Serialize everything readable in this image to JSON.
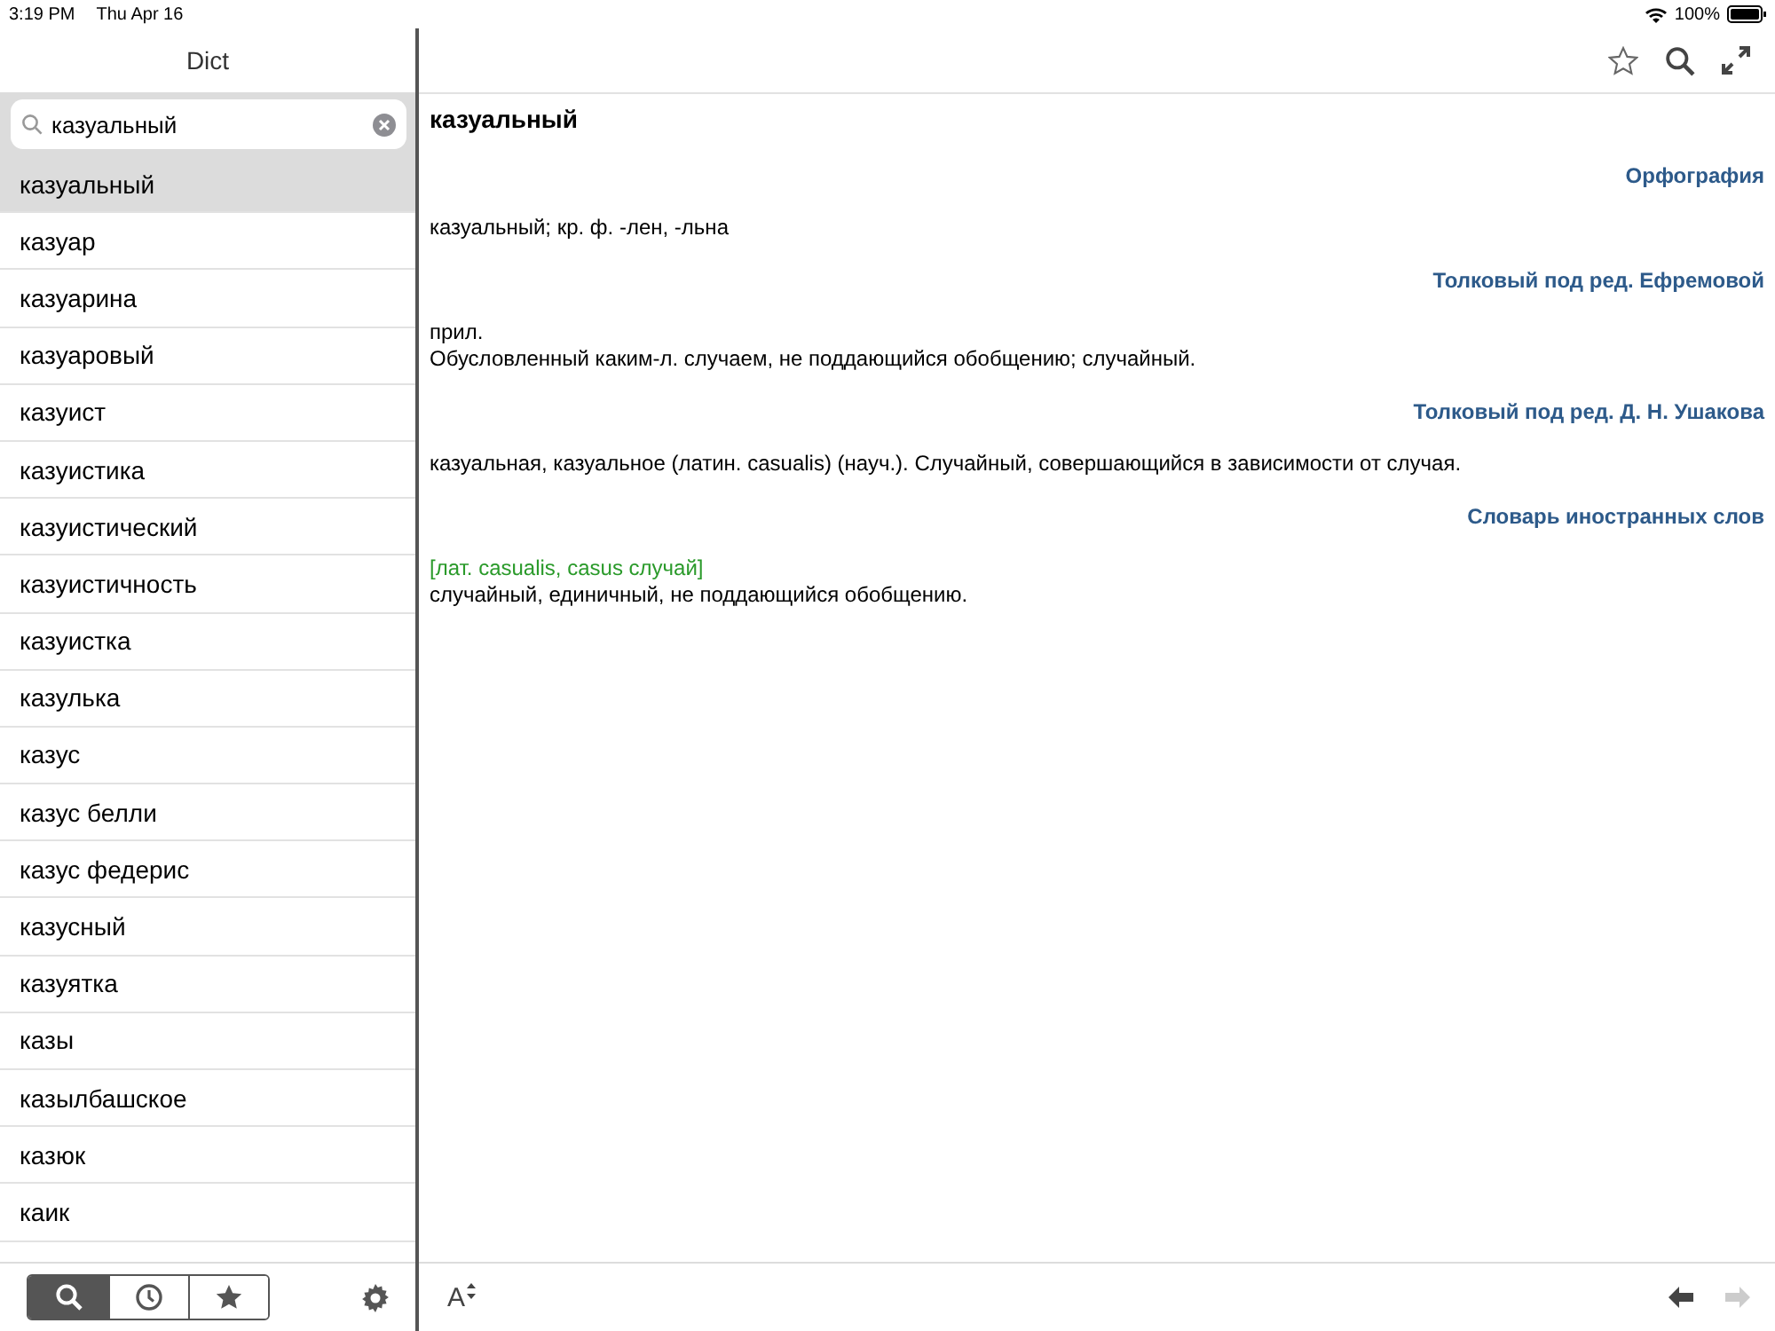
{
  "status_bar": {
    "time": "3:19 PM",
    "date": "Thu Apr 16",
    "battery": "100%"
  },
  "sidebar": {
    "title": "Dict",
    "search": {
      "value": "казуальный"
    },
    "items": [
      {
        "label": "казуальный",
        "selected": true
      },
      {
        "label": "казуар",
        "selected": false
      },
      {
        "label": "казуарина",
        "selected": false
      },
      {
        "label": "казуаровый",
        "selected": false
      },
      {
        "label": "казуист",
        "selected": false
      },
      {
        "label": "казуистика",
        "selected": false
      },
      {
        "label": "казуистический",
        "selected": false
      },
      {
        "label": "казуистичность",
        "selected": false
      },
      {
        "label": "казуистка",
        "selected": false
      },
      {
        "label": "казулька",
        "selected": false
      },
      {
        "label": "казус",
        "selected": false
      },
      {
        "label": "казус белли",
        "selected": false
      },
      {
        "label": "казус федерис",
        "selected": false
      },
      {
        "label": "казусный",
        "selected": false
      },
      {
        "label": "казуятка",
        "selected": false
      },
      {
        "label": "казы",
        "selected": false
      },
      {
        "label": "казылбашское",
        "selected": false
      },
      {
        "label": "казюк",
        "selected": false
      },
      {
        "label": "каик",
        "selected": false
      }
    ],
    "tabs": [
      {
        "kind": "search",
        "selected": true
      },
      {
        "kind": "history",
        "selected": false
      },
      {
        "kind": "favorites",
        "selected": false
      }
    ]
  },
  "article": {
    "headword": "казуальный",
    "sections": [
      {
        "source": "Орфография",
        "lines": [
          {
            "kind": "text",
            "text": "казуальный; кр. ф. -лен, -льна"
          }
        ]
      },
      {
        "source": "Толковый под ред. Ефремовой",
        "lines": [
          {
            "kind": "text",
            "text": "прил."
          },
          {
            "kind": "text",
            "text": "Обусловленный каким-л. случаем, не поддающийся обобщению; случайный."
          }
        ]
      },
      {
        "source": "Толковый под ред. Д. Н. Ушакова",
        "lines": [
          {
            "kind": "text",
            "text": "казуальная, казуальное (латин. casualis) (науч.). Случайный, совершающийся в зависимости от случая."
          }
        ]
      },
      {
        "source": "Словарь иностранных слов",
        "lines": [
          {
            "kind": "note",
            "text": "[лат. casualis, casus случай]"
          },
          {
            "kind": "text",
            "text": "случайный, единичный, не поддающийся обобщению."
          }
        ]
      }
    ]
  },
  "font_size_button": {
    "label": "A"
  },
  "navigation": {
    "back_disabled": false,
    "forward_disabled": true
  }
}
